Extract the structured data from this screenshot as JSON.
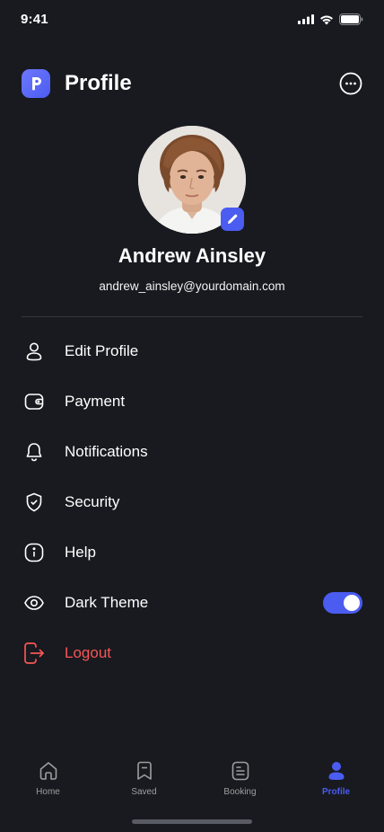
{
  "status_bar": {
    "time": "9:41"
  },
  "header": {
    "title": "Profile",
    "logo_icon": "p-logo-icon",
    "more_icon": "more-circle-icon"
  },
  "profile": {
    "name": "Andrew Ainsley",
    "email": "andrew_ainsley@yourdomain.com",
    "avatar_icon": "avatar-photo",
    "edit_icon": "pencil-icon"
  },
  "menu": {
    "items": [
      {
        "label": "Edit Profile",
        "icon": "user-icon"
      },
      {
        "label": "Payment",
        "icon": "wallet-icon"
      },
      {
        "label": "Notifications",
        "icon": "bell-icon"
      },
      {
        "label": "Security",
        "icon": "shield-icon"
      },
      {
        "label": "Help",
        "icon": "info-icon"
      },
      {
        "label": "Dark Theme",
        "icon": "eye-icon",
        "toggle_on": true
      },
      {
        "label": "Logout",
        "icon": "logout-icon"
      }
    ]
  },
  "tabbar": {
    "tabs": [
      {
        "label": "Home",
        "icon": "home-icon"
      },
      {
        "label": "Saved",
        "icon": "bookmark-icon"
      },
      {
        "label": "Booking",
        "icon": "document-icon"
      },
      {
        "label": "Profile",
        "icon": "profile-icon",
        "active": true
      }
    ]
  },
  "colors": {
    "background": "#181A20",
    "accent": "#4B5CF0",
    "danger": "#F75555",
    "divider": "#35383F",
    "inactive": "#9E9E9E"
  }
}
